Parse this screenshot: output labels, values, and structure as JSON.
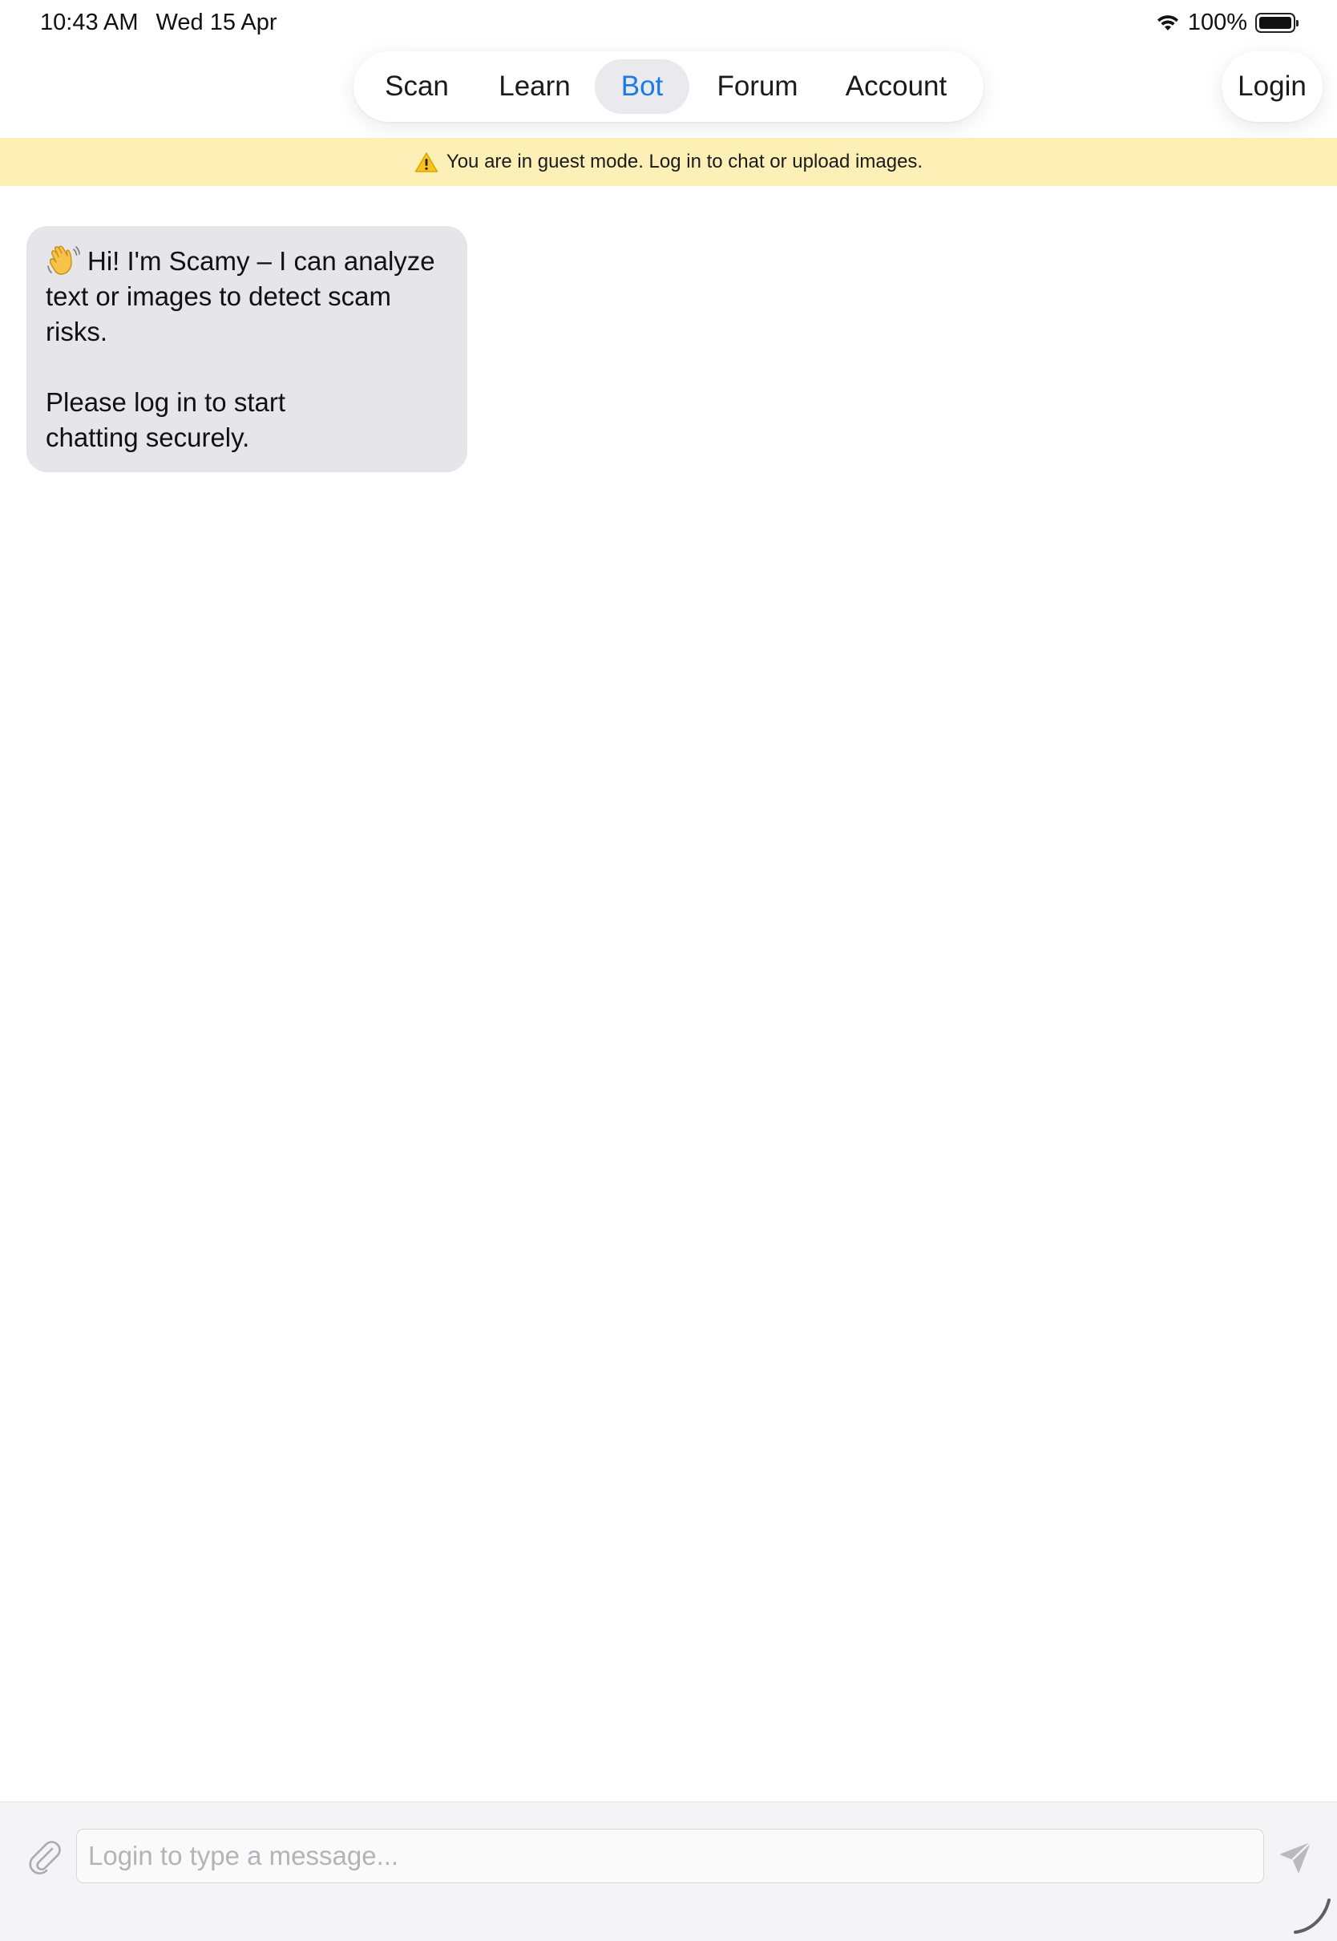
{
  "status_bar": {
    "time": "10:43 AM",
    "date": "Wed 15 Apr",
    "battery": "100%"
  },
  "nav": {
    "tabs": [
      {
        "label": "Scan",
        "active": false
      },
      {
        "label": "Learn",
        "active": false
      },
      {
        "label": "Bot",
        "active": true
      },
      {
        "label": "Forum",
        "active": false
      },
      {
        "label": "Account",
        "active": false
      }
    ],
    "login_label": "Login"
  },
  "banner": {
    "icon": "warning-icon",
    "text": "You are in guest mode. Log in to chat or upload images."
  },
  "chat": {
    "messages": [
      {
        "sender": "bot",
        "icon": "waving-hand-icon",
        "line1": "Hi! I'm Scamy – I can analyze text or images to detect scam risks.",
        "line2": "Please log in to start chatting securely."
      }
    ]
  },
  "composer": {
    "placeholder": "Login to type a message...",
    "value": "",
    "attach_icon": "paperclip-icon",
    "send_icon": "send-icon"
  },
  "colors": {
    "accent": "#1a7be6",
    "banner_bg": "#fdf0b6",
    "bubble_bg": "#e5e5ea",
    "active_tab_bg": "#e9e9ee"
  }
}
